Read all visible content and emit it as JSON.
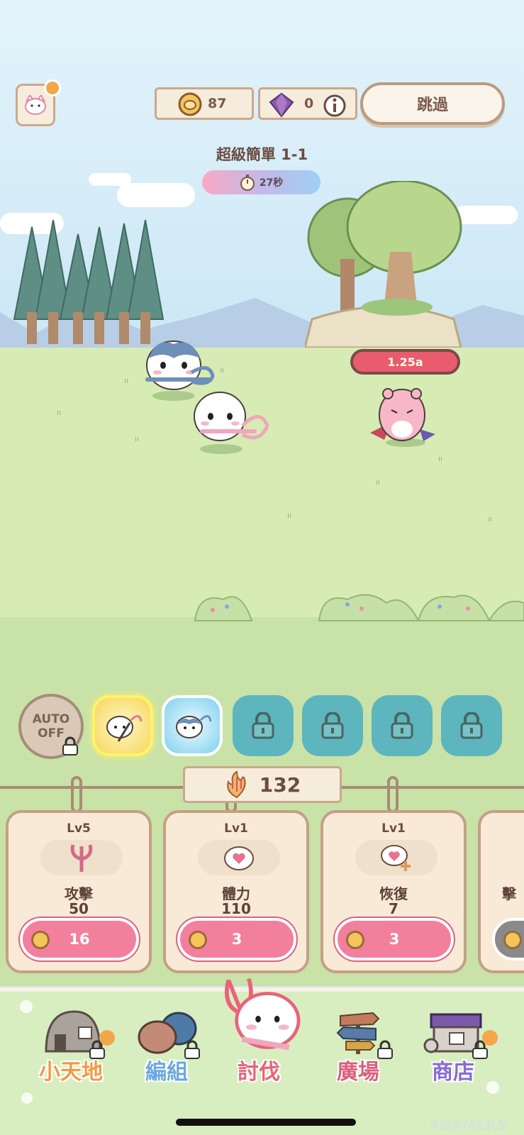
{
  "hud": {
    "coins": "87",
    "gems": "0",
    "skip_label": "跳過",
    "coin_icon": "coin-icon",
    "gem_icon": "gem-icon",
    "info_icon": "info-icon",
    "profile_icon": "cat-face-icon"
  },
  "stage": {
    "title": "超級簡單 1-1",
    "timer": "27秒",
    "timer_icon": "stopwatch-icon"
  },
  "battle": {
    "enemy_hp_label": "1.25a"
  },
  "skills": {
    "auto_line1": "AUTO",
    "auto_line2": "OFF",
    "slots": [
      {
        "state": "equipped",
        "icon": "chiikawa-weapon-icon"
      },
      {
        "state": "equipped",
        "icon": "hachiware-weapon-icon"
      },
      {
        "state": "locked",
        "icon": "lock-icon"
      },
      {
        "state": "locked",
        "icon": "lock-icon"
      },
      {
        "state": "locked",
        "icon": "lock-icon"
      },
      {
        "state": "locked",
        "icon": "lock-icon"
      }
    ]
  },
  "counter": {
    "value": "132",
    "icon": "flame-trident-icon"
  },
  "upgrades": [
    {
      "level": "Lv5",
      "name": "攻擊",
      "value": "50",
      "cost": "16",
      "icon": "trident-icon"
    },
    {
      "level": "Lv1",
      "name": "體力",
      "value": "110",
      "cost": "3",
      "icon": "heart-face-icon"
    },
    {
      "level": "Lv1",
      "name": "恢復",
      "value": "7",
      "cost": "3",
      "icon": "heart-plus-icon"
    },
    {
      "level": "",
      "name": "擊",
      "value": "",
      "cost": "",
      "icon": "coin-icon"
    }
  ],
  "nav": {
    "items": [
      {
        "label": "小天地",
        "icon": "house-icon",
        "locked": true,
        "color": "#f29a45"
      },
      {
        "label": "編組",
        "icon": "team-icon",
        "locked": true,
        "color": "#6aa7e0"
      },
      {
        "label": "討伐",
        "icon": "battle-icon",
        "locked": false,
        "color": "#e8637a"
      },
      {
        "label": "廣場",
        "icon": "signpost-icon",
        "locked": true,
        "color": "#d9607d"
      },
      {
        "label": "商店",
        "icon": "shop-icon",
        "locked": true,
        "color": "#8a6ad8"
      }
    ]
  },
  "watermark": "4GAMERS"
}
